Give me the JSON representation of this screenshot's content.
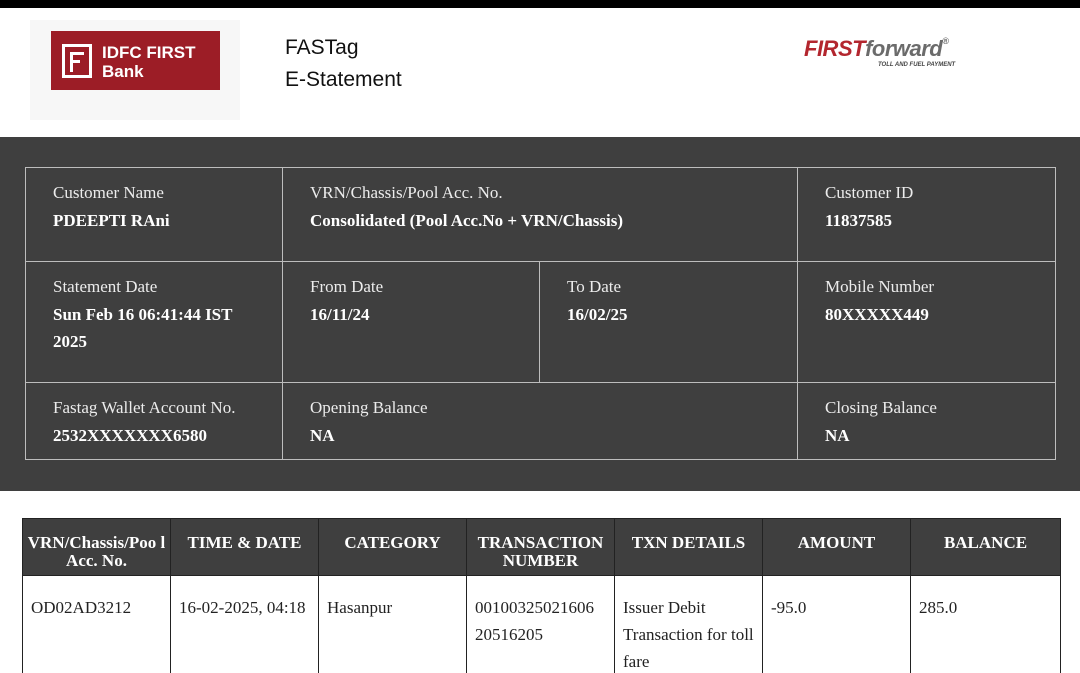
{
  "header": {
    "bank_logo_line1": "IDFC FIRST",
    "bank_logo_line2": "Bank",
    "doc_title_line1": "FASTag",
    "doc_title_line2": "E-Statement",
    "ff_logo_first": "FIRST",
    "ff_logo_forward": "forward",
    "ff_logo_reg": "®",
    "ff_logo_tagline": "TOLL AND FUEL PAYMENT"
  },
  "customer": {
    "name_label": "Customer Name",
    "name_value": "PDEEPTI RAni",
    "vrn_label": "VRN/Chassis/Pool Acc. No.",
    "vrn_value": "Consolidated (Pool Acc.No + VRN/Chassis)",
    "customer_id_label": "Customer ID",
    "customer_id_value": "11837585",
    "statement_date_label": "Statement Date",
    "statement_date_value": "Sun Feb 16 06:41:44 IST 2025",
    "from_date_label": "From Date",
    "from_date_value": "16/11/24",
    "to_date_label": "To Date",
    "to_date_value": "16/02/25",
    "mobile_label": "Mobile Number",
    "mobile_value": "80XXXXX449",
    "wallet_label": "Fastag Wallet Account No.",
    "wallet_value": "2532XXXXXXX6580",
    "opening_label": "Opening Balance",
    "opening_value": "NA",
    "closing_label": "Closing Balance",
    "closing_value": "NA"
  },
  "transactions": {
    "columns": [
      "VRN/Chassis/Poo l Acc. No.",
      "TIME & DATE",
      "CATEGORY",
      "TRANSACTION NUMBER",
      "TXN DETAILS",
      "AMOUNT",
      "BALANCE"
    ],
    "rows": [
      {
        "vrn": "OD02AD3212",
        "time_date": "16-02-2025, 04:18",
        "category": "Hasanpur",
        "txn_number": "00100325021606 20516205",
        "details": "Issuer Debit Transaction for toll fare",
        "amount": "-95.0",
        "balance": "285.0"
      }
    ]
  },
  "colors": {
    "panel_bg": "#3f3f3f",
    "bank_red": "#9c1d26",
    "brand_red": "#b3262e",
    "brand_grey": "#6b6b6b"
  }
}
